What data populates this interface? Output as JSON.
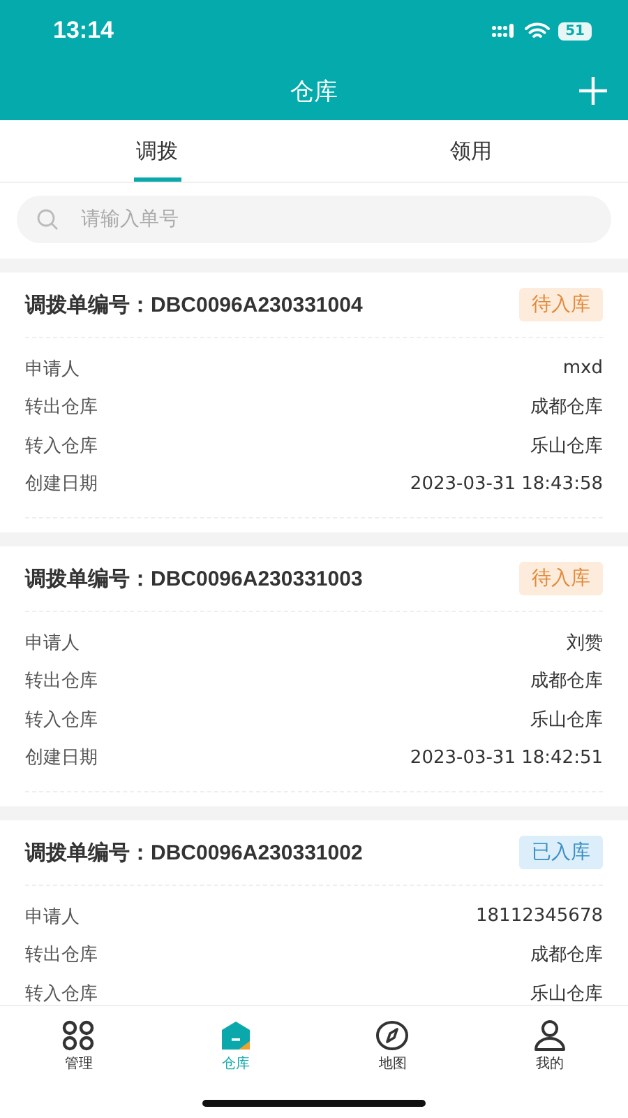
{
  "status_bar": {
    "time": "13:14",
    "battery": "51"
  },
  "header": {
    "title": "仓库"
  },
  "tabs": [
    {
      "label": "调拨",
      "selected": true
    },
    {
      "label": "领用",
      "selected": false
    }
  ],
  "search": {
    "placeholder": "请输入单号"
  },
  "orders": [
    {
      "number": "调拨单编号：DBC0096A230331004",
      "status": {
        "label": "待入库",
        "kind": "pending"
      },
      "fields": [
        {
          "label": "申请人",
          "value": "mxd"
        },
        {
          "label": "转出仓库",
          "value": "成都仓库"
        },
        {
          "label": "转入仓库",
          "value": "乐山仓库"
        },
        {
          "label": "创建日期",
          "value": "2023-03-31 18:43:58"
        }
      ]
    },
    {
      "number": "调拨单编号：DBC0096A230331003",
      "status": {
        "label": "待入库",
        "kind": "pending"
      },
      "fields": [
        {
          "label": "申请人",
          "value": "刘赞"
        },
        {
          "label": "转出仓库",
          "value": "成都仓库"
        },
        {
          "label": "转入仓库",
          "value": "乐山仓库"
        },
        {
          "label": "创建日期",
          "value": "2023-03-31 18:42:51"
        }
      ]
    },
    {
      "number": "调拨单编号：DBC0096A230331002",
      "status": {
        "label": "已入库",
        "kind": "done"
      },
      "fields": [
        {
          "label": "申请人",
          "value": "18112345678"
        },
        {
          "label": "转出仓库",
          "value": "成都仓库"
        },
        {
          "label": "转入仓库",
          "value": "乐山仓库"
        }
      ]
    }
  ],
  "nav": [
    {
      "label": "管理",
      "kind": "grid",
      "selected": false
    },
    {
      "label": "仓库",
      "kind": "house",
      "selected": true
    },
    {
      "label": "地图",
      "kind": "compass",
      "selected": false
    },
    {
      "label": "我的",
      "kind": "person",
      "selected": false
    }
  ]
}
